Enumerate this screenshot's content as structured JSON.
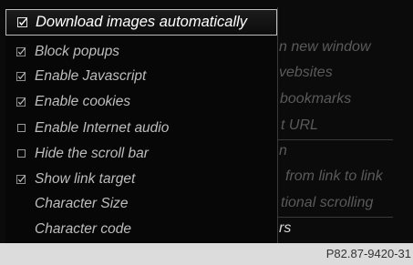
{
  "background_menu": {
    "items": [
      {
        "label": "n new window"
      },
      {
        "label": "vebsites"
      },
      {
        "label": "bookmarks"
      },
      {
        "label": "t URL"
      },
      {
        "label": "n"
      },
      {
        "label": "from link to link"
      },
      {
        "label": "tional scrolling"
      },
      {
        "label": "rs"
      }
    ]
  },
  "options_menu": {
    "items": [
      {
        "label": "Download images automatically",
        "checked": true
      },
      {
        "label": "Block popups",
        "checked": true
      },
      {
        "label": "Enable Javascript",
        "checked": true
      },
      {
        "label": "Enable cookies",
        "checked": true
      },
      {
        "label": "Enable Internet audio",
        "checked": false
      },
      {
        "label": "Hide the scroll bar",
        "checked": false
      },
      {
        "label": "Show link target",
        "checked": true
      },
      {
        "label": "Character Size",
        "checked": null
      },
      {
        "label": "Character code",
        "checked": null
      }
    ]
  },
  "footer": {
    "image_code": "P82.87-9420-31"
  }
}
